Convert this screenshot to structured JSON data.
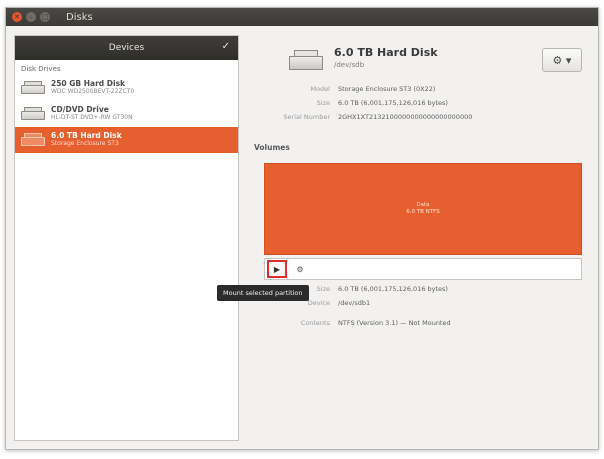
{
  "window": {
    "title": "Disks"
  },
  "sidebar": {
    "header": "Devices",
    "section_label": "Disk Drives",
    "devices": [
      {
        "name": "250 GB Hard Disk",
        "sub": "WDC WD2500BEVT-22ZCT0"
      },
      {
        "name": "CD/DVD Drive",
        "sub": "HL-DT-ST DVD+-RW GT30N"
      },
      {
        "name": "6.0 TB Hard Disk",
        "sub": "Storage Enclosure ST3"
      }
    ],
    "selected_index": 2
  },
  "disk": {
    "title": "6.0 TB Hard Disk",
    "subtitle": "/dev/sdb",
    "info": [
      {
        "label": "Model",
        "value": "Storage Enclosure ST3 (0X22)"
      },
      {
        "label": "Size",
        "value": "6.0 TB (6,001,175,126,016 bytes)"
      },
      {
        "label": "Serial Number",
        "value": "2GHX1XT2132100000000000000000000"
      }
    ]
  },
  "volumes": {
    "label": "Volumes",
    "partition": {
      "line1": "Data",
      "line2": "6.0 TB NTFS"
    },
    "tooltip": "Mount selected partition"
  },
  "volume_info": [
    {
      "label": "Size",
      "value": "6.0 TB (6,001,175,126,016 bytes)"
    },
    {
      "label": "Device",
      "value": "/dev/sdb1"
    },
    {
      "label": "Contents",
      "value": "NTFS (Version 3.1) — Not Mounted"
    }
  ]
}
